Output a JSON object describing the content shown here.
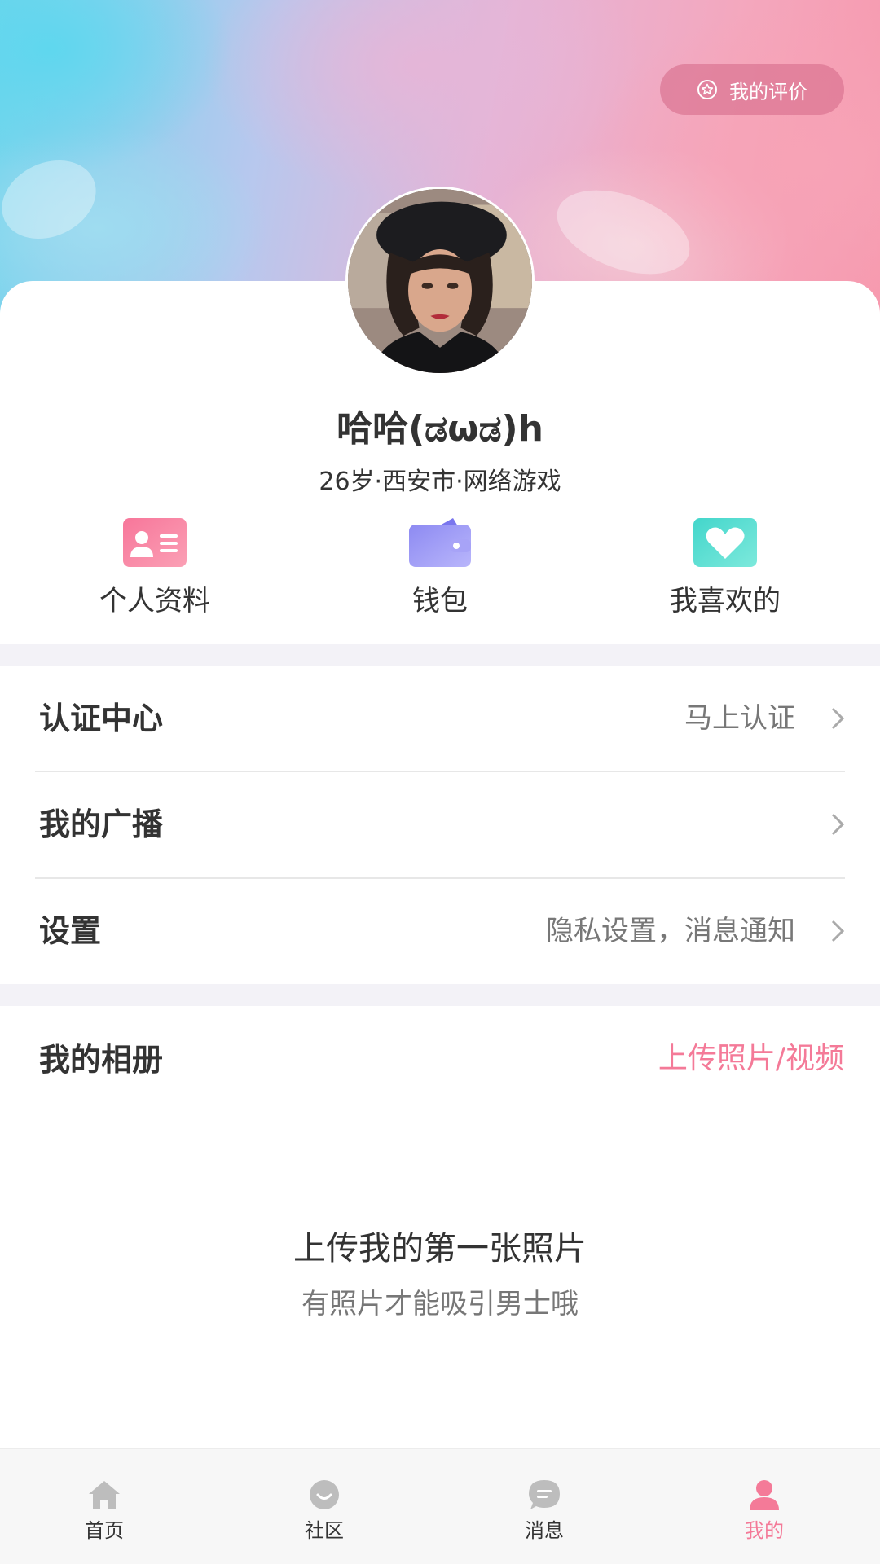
{
  "header": {
    "rating_button": "我的评价"
  },
  "profile": {
    "username": "哈哈(ಡωಡ)h",
    "info": "26岁·西安市·网络游戏"
  },
  "quick_actions": [
    {
      "label": "个人资料",
      "icon": "id-card-icon",
      "color": "#f77f9e"
    },
    {
      "label": "钱包",
      "icon": "wallet-icon",
      "color": "#9f9cf6"
    },
    {
      "label": "我喜欢的",
      "icon": "heart-icon",
      "color": "#5edfd3"
    }
  ],
  "menu": [
    {
      "title": "认证中心",
      "value": "马上认证"
    },
    {
      "title": "我的广播",
      "value": ""
    },
    {
      "title": "设置",
      "value": "隐私设置，消息通知"
    }
  ],
  "album": {
    "title": "我的相册",
    "upload": "上传照片/视频",
    "empty_title": "上传我的第一张照片",
    "empty_subtitle": "有照片才能吸引男士哦"
  },
  "tabbar": {
    "items": [
      {
        "label": "首页",
        "icon": "home-icon"
      },
      {
        "label": "社区",
        "icon": "community-icon"
      },
      {
        "label": "消息",
        "icon": "message-icon"
      },
      {
        "label": "我的",
        "icon": "profile-icon"
      }
    ],
    "active_index": 3,
    "active_color": "#f47a98"
  },
  "colors": {
    "accent": "#f47a98",
    "separator": "#f3f2f7"
  }
}
